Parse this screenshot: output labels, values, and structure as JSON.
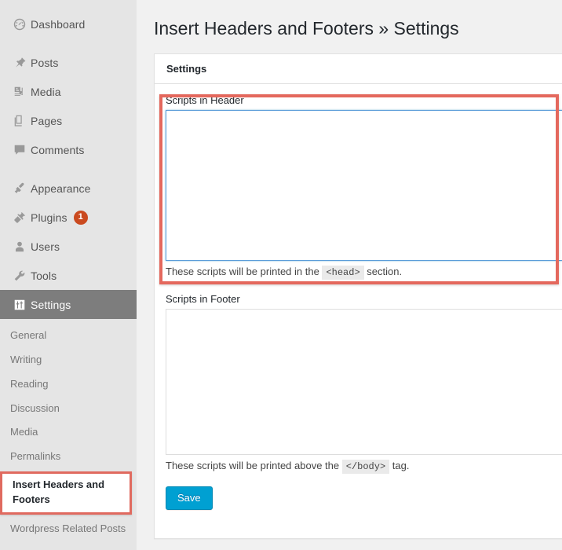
{
  "colors": {
    "sidebar_bg": "#e5e5e5",
    "active_item_bg": "#7d7d7d",
    "badge_bg": "#ca4a1f",
    "annotation_red": "#e4685d",
    "save_button_bg": "#00a0d2",
    "focus_border": "#5b9dd9",
    "content_bg": "#f1f1f1"
  },
  "sidebar": {
    "items": [
      {
        "label": "Dashboard",
        "icon": "dashboard-icon",
        "badge": null,
        "active": false
      },
      {
        "label": "Posts",
        "icon": "pin-icon",
        "badge": null,
        "active": false
      },
      {
        "label": "Media",
        "icon": "media-icon",
        "badge": null,
        "active": false
      },
      {
        "label": "Pages",
        "icon": "pages-icon",
        "badge": null,
        "active": false
      },
      {
        "label": "Comments",
        "icon": "comment-icon",
        "badge": null,
        "active": false
      },
      {
        "label": "Appearance",
        "icon": "paintbrush-icon",
        "badge": null,
        "active": false
      },
      {
        "label": "Plugins",
        "icon": "plug-icon",
        "badge": "1",
        "active": false
      },
      {
        "label": "Users",
        "icon": "user-icon",
        "badge": null,
        "active": false
      },
      {
        "label": "Tools",
        "icon": "wrench-icon",
        "badge": null,
        "active": false
      },
      {
        "label": "Settings",
        "icon": "sliders-icon",
        "badge": null,
        "active": true
      }
    ],
    "submenu": [
      {
        "label": "General",
        "highlighted": false
      },
      {
        "label": "Writing",
        "highlighted": false
      },
      {
        "label": "Reading",
        "highlighted": false
      },
      {
        "label": "Discussion",
        "highlighted": false
      },
      {
        "label": "Media",
        "highlighted": false
      },
      {
        "label": "Permalinks",
        "highlighted": false
      },
      {
        "label": "Insert Headers and Footers",
        "highlighted": true
      },
      {
        "label": "Wordpress Related Posts",
        "highlighted": false
      }
    ]
  },
  "main": {
    "page_title": "Insert Headers and Footers » Settings",
    "card": {
      "tab_label": "Settings",
      "header_field": {
        "label": "Scripts in Header",
        "value": "",
        "placeholder": "",
        "help_prefix": "These scripts will be printed in the",
        "help_code": "<head>",
        "help_suffix": "section."
      },
      "footer_field": {
        "label": "Scripts in Footer",
        "value": "",
        "placeholder": "",
        "help_prefix": "These scripts will be printed above the",
        "help_code": "</body>",
        "help_suffix": "tag."
      },
      "save_label": "Save"
    }
  }
}
